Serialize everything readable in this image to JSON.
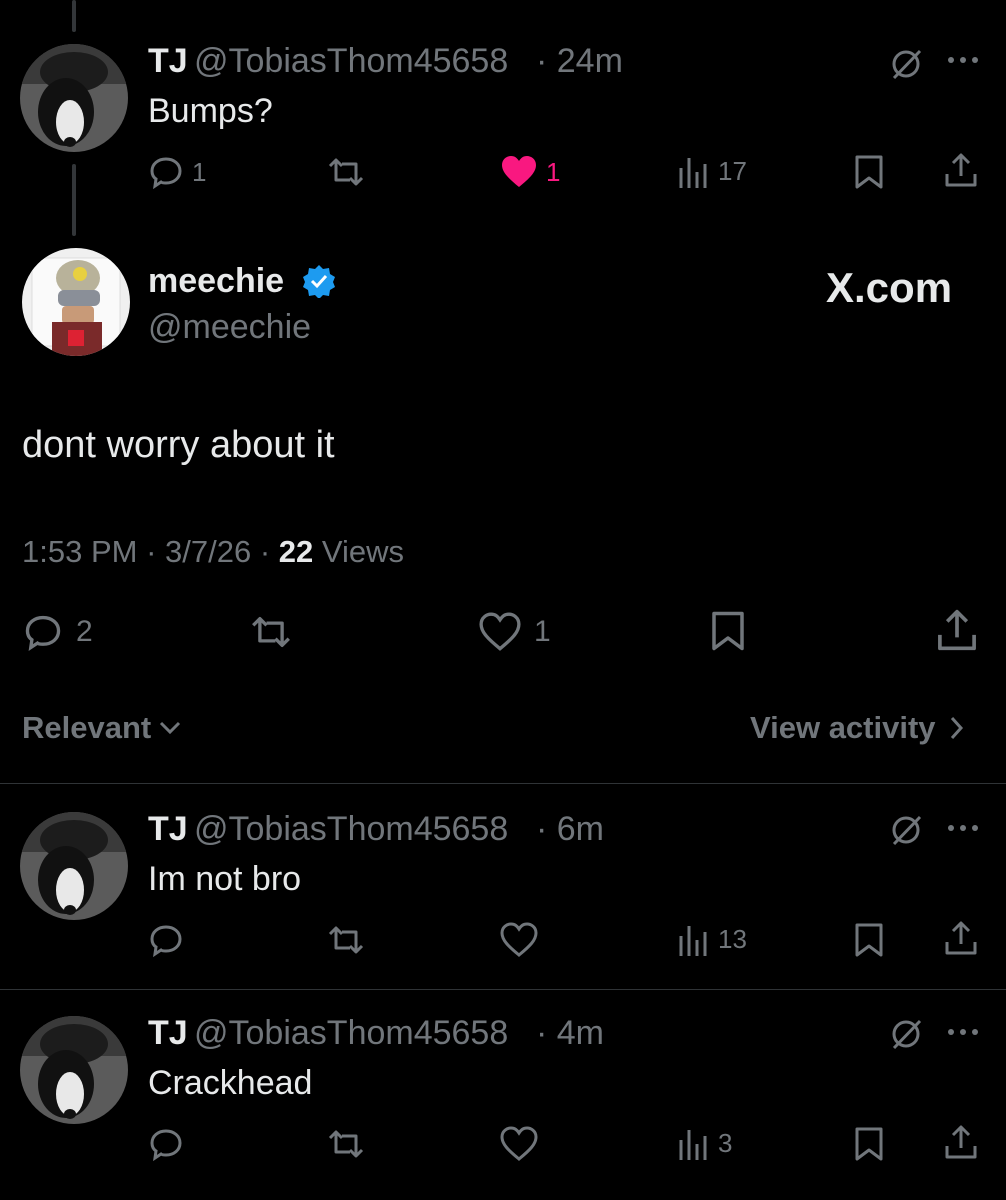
{
  "colors": {
    "background": "#000000",
    "text": "#e7e9ea",
    "muted": "#71767b",
    "like_active": "#f91880",
    "verified": "#1d9bf0"
  },
  "parent_reply": {
    "name": "TJ",
    "handle": "@TobiasThom45658",
    "time": "· 24m",
    "text": "Bumps?",
    "replies": "1",
    "likes": "1",
    "liked": true,
    "views": "17"
  },
  "main_post": {
    "name": "meechie",
    "verified": true,
    "handle": "@meechie",
    "watermark": "X.com",
    "text": "dont worry about it",
    "time": "1:53 PM",
    "date": "· 3/7/26 ·",
    "views_count": "22",
    "views_label": "Views",
    "replies": "2",
    "likes": "1"
  },
  "sort": {
    "label": "Relevant",
    "activity_label": "View activity"
  },
  "replies": [
    {
      "name": "TJ",
      "handle": "@TobiasThom45658",
      "time": "· 6m",
      "text": "Im not bro",
      "views": "13"
    },
    {
      "name": "TJ",
      "handle": "@TobiasThom45658",
      "time": "· 4m",
      "text": "Crackhead",
      "views": "3"
    }
  ]
}
